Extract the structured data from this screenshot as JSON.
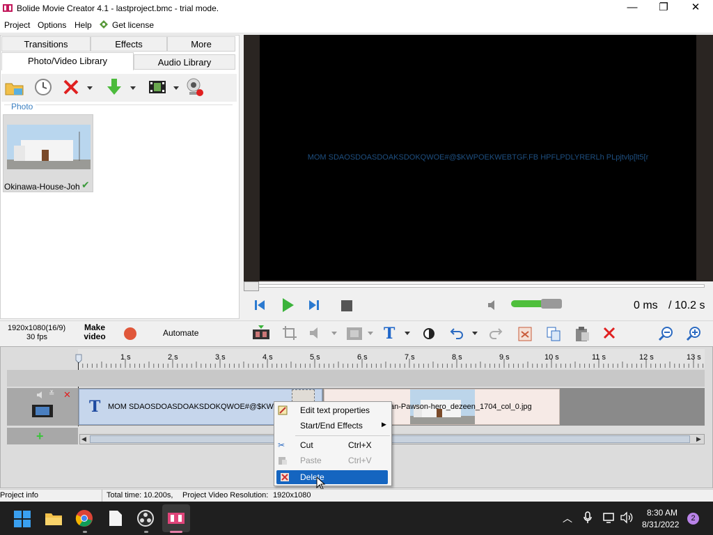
{
  "window": {
    "title": "Bolide Movie Creator 4.1 - lastproject.bmc - trial mode.",
    "minimize": "—",
    "maximize": "❐",
    "close": "✕"
  },
  "menu": {
    "project": "Project",
    "options": "Options",
    "help": "Help",
    "license": "Get license"
  },
  "tabs": {
    "transitions": "Transitions",
    "effects": "Effects",
    "more": "More",
    "photo_video": "Photo/Video Library",
    "audio": "Audio Library"
  },
  "library": {
    "section": "Photo",
    "items": [
      {
        "label": "Okinawa-House-Joh"
      }
    ]
  },
  "preview": {
    "overlay_text": "MOM SDAOSDOASDOAKSDOKQWOE#@$KWPOEKWEBTGF.FB HPFLPDLYRERLh PLpjtvlp[lt5[r",
    "time_current": "0 ms",
    "time_total": "/ 10.2 s",
    "volume_level": 0.75
  },
  "project": {
    "resolution": "1920x1080(16/9)",
    "fps": "30 fps",
    "make_video": "Make video",
    "automate": "Automate"
  },
  "ruler": {
    "labels": [
      "1 s",
      "2 s",
      "3 s",
      "4 s",
      "5 s",
      "6 s",
      "7 s",
      "8 s",
      "9 s",
      "10 s",
      "11 s",
      "12 s",
      "13 s"
    ]
  },
  "timeline": {
    "text_clip": "MOM SDAOSDOASDOAKSDOKQWOE#@$KWPOE",
    "image_clip": "an-Pawson-hero_dezeen_1704_col_0.jpg"
  },
  "context_menu": {
    "items": [
      {
        "label": "Edit text properties",
        "shortcut": ""
      },
      {
        "label": "Start/End Effects",
        "shortcut": ""
      },
      {
        "label": "Cut",
        "shortcut": "Ctrl+X"
      },
      {
        "label": "Paste",
        "shortcut": "Ctrl+V"
      },
      {
        "label": "Delete",
        "shortcut": ""
      }
    ]
  },
  "status": {
    "info": "Project info",
    "total_time": "Total time: 10.200s,",
    "resolution_label": "Project Video Resolution:",
    "resolution_value": "1920x1080"
  },
  "taskbar": {
    "time": "8:30 AM",
    "date": "8/31/2022",
    "notifications": "2"
  },
  "colors": {
    "accent": "#0a63d6",
    "selection": "#1565c0",
    "preview_text": "#1e4f80"
  }
}
